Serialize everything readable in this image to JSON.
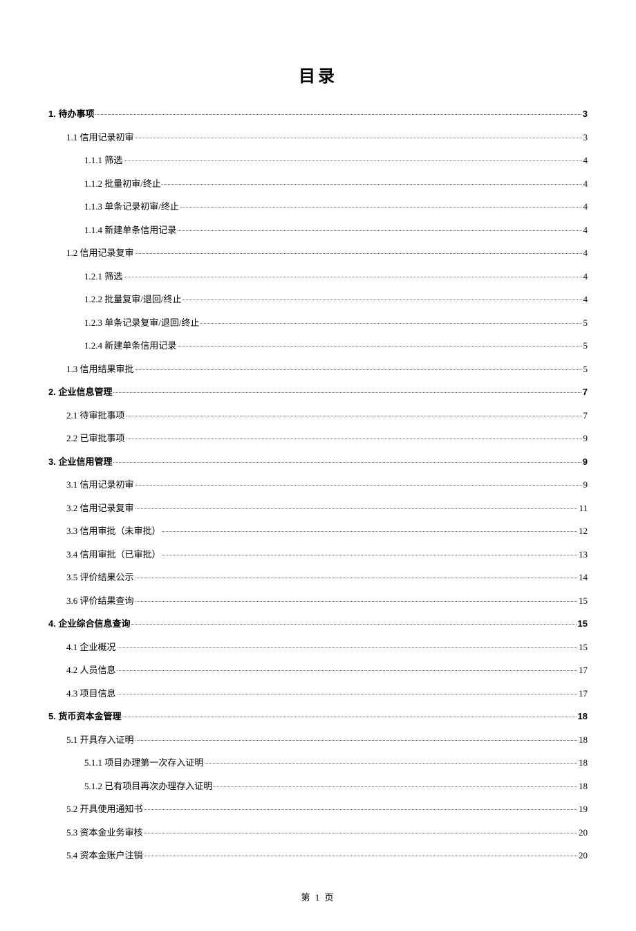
{
  "title": "目录",
  "footer": "第 1 页",
  "entries": [
    {
      "level": 1,
      "label": "1. 待办事项",
      "page": "3"
    },
    {
      "level": 2,
      "label": "1.1 信用记录初审",
      "page": "3"
    },
    {
      "level": 3,
      "label": "1.1.1 筛选",
      "page": "4"
    },
    {
      "level": 3,
      "label": "1.1.2 批量初审/终止",
      "page": "4"
    },
    {
      "level": 3,
      "label": "1.1.3 单条记录初审/终止",
      "page": "4"
    },
    {
      "level": 3,
      "label": "1.1.4 新建单条信用记录",
      "page": "4"
    },
    {
      "level": 2,
      "label": "1.2 信用记录复审",
      "page": "4"
    },
    {
      "level": 3,
      "label": "1.2.1 筛选",
      "page": "4"
    },
    {
      "level": 3,
      "label": "1.2.2 批量复审/退回/终止",
      "page": "4"
    },
    {
      "level": 3,
      "label": "1.2.3 单条记录复审/退回/终止",
      "page": "5"
    },
    {
      "level": 3,
      "label": "1.2.4 新建单条信用记录",
      "page": "5"
    },
    {
      "level": 2,
      "label": "1.3 信用结果审批",
      "page": "5"
    },
    {
      "level": 1,
      "label": "2. 企业信息管理",
      "page": "7"
    },
    {
      "level": 2,
      "label": "2.1 待审批事项",
      "page": "7"
    },
    {
      "level": 2,
      "label": "2.2 已审批事项",
      "page": "9"
    },
    {
      "level": 1,
      "label": "3. 企业信用管理",
      "page": "9"
    },
    {
      "level": 2,
      "label": "3.1 信用记录初审",
      "page": "9"
    },
    {
      "level": 2,
      "label": "3.2 信用记录复审",
      "page": "11"
    },
    {
      "level": 2,
      "label": "3.3 信用审批（未审批）",
      "page": "12"
    },
    {
      "level": 2,
      "label": "3.4 信用审批（已审批）",
      "page": "13"
    },
    {
      "level": 2,
      "label": "3.5 评价结果公示",
      "page": "14"
    },
    {
      "level": 2,
      "label": "3.6 评价结果查询",
      "page": "15"
    },
    {
      "level": 1,
      "label": "4. 企业综合信息查询",
      "page": "15"
    },
    {
      "level": 2,
      "label": "4.1 企业概况",
      "page": "15"
    },
    {
      "level": 2,
      "label": "4.2 人员信息",
      "page": "17"
    },
    {
      "level": 2,
      "label": "4.3 项目信息",
      "page": "17"
    },
    {
      "level": 1,
      "label": "5. 货币资本金管理",
      "page": "18"
    },
    {
      "level": 2,
      "label": "5.1 开具存入证明",
      "page": "18"
    },
    {
      "level": 3,
      "label": "5.1.1 项目办理第一次存入证明",
      "page": "18"
    },
    {
      "level": 3,
      "label": "5.1.2 已有项目再次办理存入证明",
      "page": "18"
    },
    {
      "level": 2,
      "label": "5.2 开具使用通知书",
      "page": "19"
    },
    {
      "level": 2,
      "label": "5.3 资本金业务审核",
      "page": "20"
    },
    {
      "level": 2,
      "label": "5.4 资本金账户注销",
      "page": "20"
    }
  ]
}
